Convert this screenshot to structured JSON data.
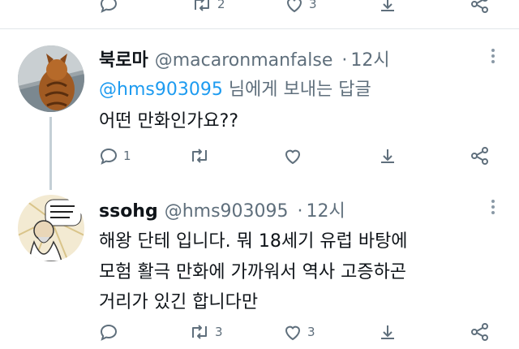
{
  "top_actions": {
    "retweets": "2",
    "likes": "3"
  },
  "tweet1": {
    "author": "북로마",
    "handle": "@macaronmanfalse",
    "separator": "·",
    "time": "12시",
    "reply_to_handle": "@hms903095",
    "reply_to_suffix": " 님에게 보내는 답글",
    "text": "어떤 만화인가요??",
    "actions": {
      "replies": "1",
      "retweets": "",
      "likes": ""
    }
  },
  "tweet2": {
    "author": "ssohg",
    "handle": "@hms903095",
    "separator": "·",
    "time": "12시",
    "text_lines": [
      "해왕 단테 입니다. 뭐 18세기 유럽 바탕에",
      "모험 활극 만화에 가까워서 역사 고증하곤",
      "거리가 있긴 합니다만"
    ],
    "actions": {
      "replies": "",
      "retweets": "3",
      "likes": "3"
    }
  },
  "colors": {
    "link": "#1d9bf0",
    "muted": "#5f6f7c",
    "thread_line": "#c4cfd6"
  }
}
